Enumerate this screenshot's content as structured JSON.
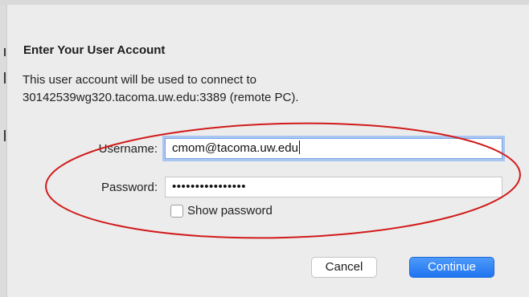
{
  "dialog": {
    "title": "Enter Your User Account",
    "description_line1": "This user account will be used to connect to",
    "description_line2": "30142539wg320.tacoma.uw.edu:3389 (remote PC)."
  },
  "form": {
    "username_label": "Username:",
    "username_value": "cmom@tacoma.uw.edu",
    "password_label": "Password:",
    "password_value": "••••••••••••••••",
    "show_password_label": "Show password",
    "show_password_checked": false
  },
  "buttons": {
    "cancel_label": "Cancel",
    "continue_label": "Continue"
  },
  "colors": {
    "accent": "#1f74f0",
    "focus_ring": "#a9c6f2",
    "annotation": "#d11a1a"
  }
}
